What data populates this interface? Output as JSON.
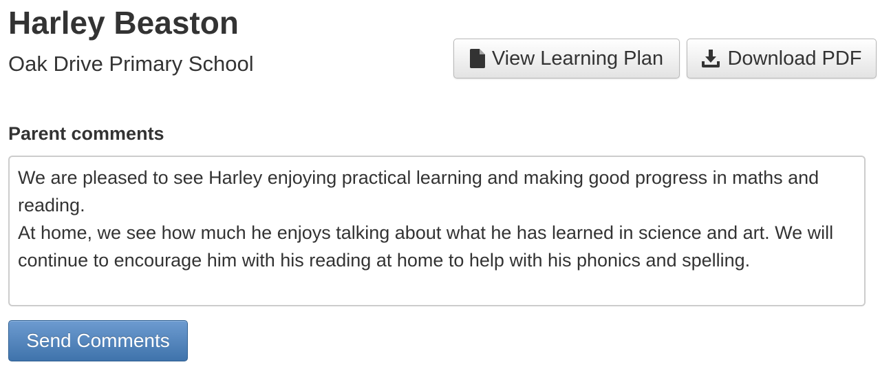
{
  "student": {
    "name": "Harley Beaston",
    "school": "Oak Drive Primary School"
  },
  "actions": {
    "view_learning_plan": {
      "label": "View Learning Plan",
      "icon": "file-icon"
    },
    "download_pdf": {
      "label": "Download PDF",
      "icon": "download-icon"
    }
  },
  "comments": {
    "label": "Parent comments",
    "value": "We are pleased to see Harley enjoying practical learning and making good progress in maths and reading.\nAt home, we see how much he enjoys talking about what he has learned in science and art. We will continue to encourage him with his reading at home to help with his phonics and spelling.",
    "send_label": "Send Comments"
  },
  "colors": {
    "text": "#333333",
    "primary_button": "#4a7eb6",
    "border": "#cccccc"
  }
}
